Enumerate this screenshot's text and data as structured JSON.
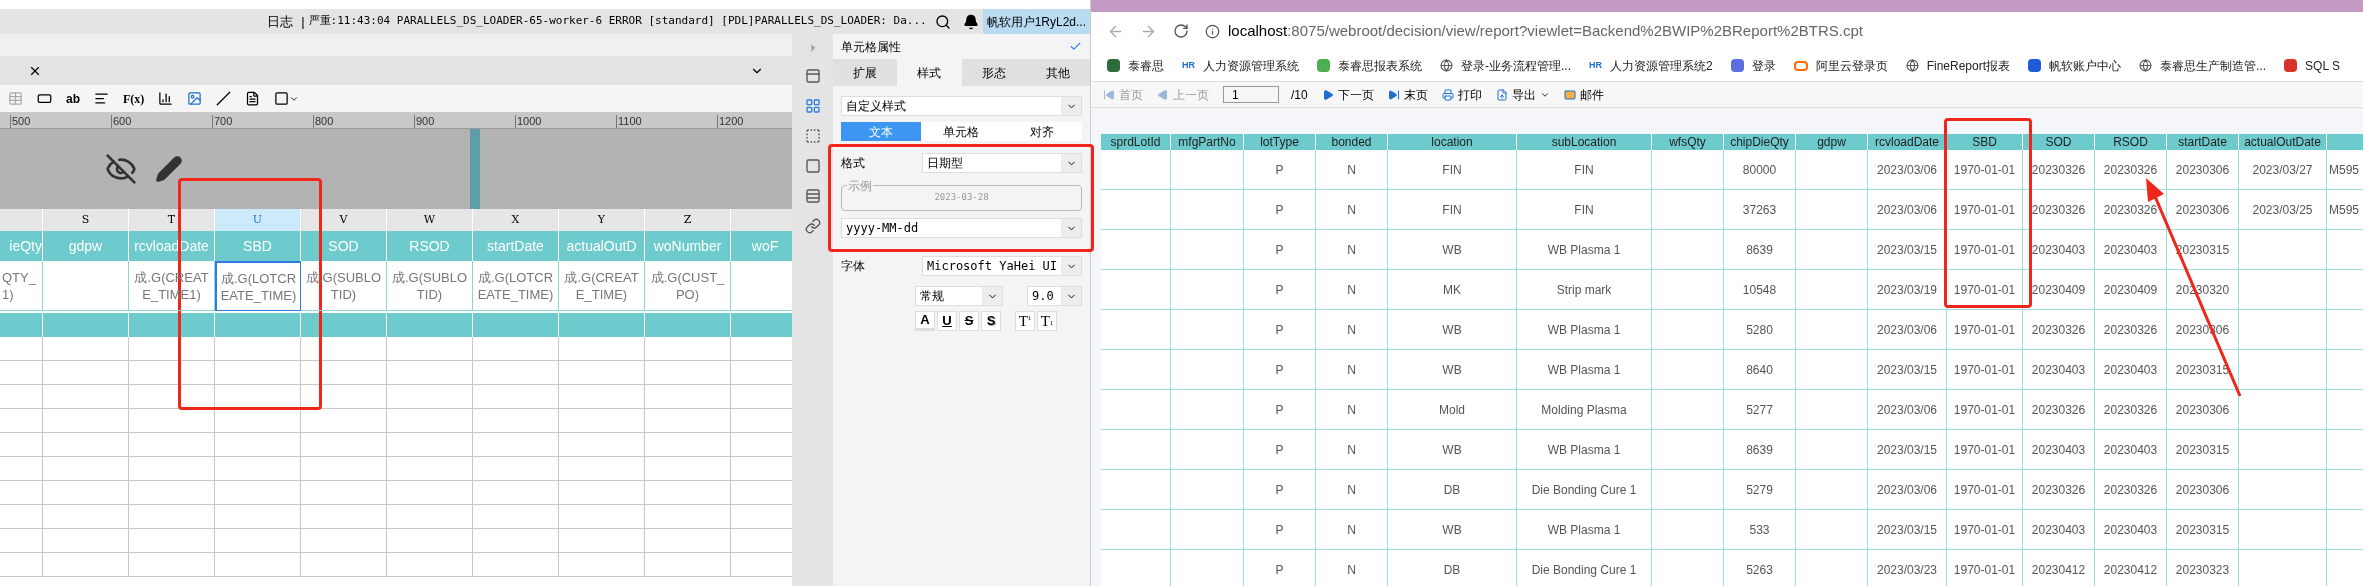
{
  "log_bar": {
    "label": "日志",
    "separator": "|",
    "message": "严重:11:43:04 PARALLELS_DS_LOADER-65-worker-6 ERROR [standard] [PDL]PARALLELS_DS_LOADER: Da...",
    "user": "帆软用户1RyL2d..."
  },
  "designer": {
    "toolbar_text": {
      "text_tool": "ab",
      "formula_tool": "F(x)"
    },
    "ruler": [
      "500",
      "600",
      "700",
      "800",
      "900",
      "1000",
      "1100",
      "1200"
    ],
    "columns": [
      {
        "header": "ieQty",
        "cell": "QTY_1)",
        "selected": false
      },
      {
        "letter": "S",
        "header": "gdpw",
        "selected": false
      },
      {
        "letter": "T",
        "header": "rcvloadDate",
        "cell": "成.G(CREATE_TIME1)",
        "selected": false
      },
      {
        "letter": "U",
        "header": "SBD",
        "cell": "成.G(LOTCREATE_TIME)",
        "selected": true
      },
      {
        "letter": "V",
        "header": "SOD",
        "cell": "成.G(SUBLOTID)",
        "selected": false
      },
      {
        "letter": "W",
        "header": "RSOD",
        "cell": "成.G(SUBLOTID)",
        "selected": false
      },
      {
        "letter": "X",
        "header": "startDate",
        "cell": "成.G(LOTCREATE_TIME)",
        "selected": false
      },
      {
        "letter": "Y",
        "header": "actualOutD",
        "cell": "成.G(CREATE_TIME)",
        "selected": false
      },
      {
        "letter": "Z",
        "header": "woNumber",
        "cell": "成.G(CUST_PO)",
        "selected": false
      },
      {
        "header": "woF",
        "selected": false
      }
    ]
  },
  "property_panel": {
    "title": "单元格属性",
    "tabs": [
      {
        "label": "扩展",
        "selected": false
      },
      {
        "label": "样式",
        "selected": true
      },
      {
        "label": "形态",
        "selected": false
      },
      {
        "label": "其他",
        "selected": false
      }
    ],
    "style_select": "自定义样式",
    "subtabs": [
      {
        "label": "文本",
        "selected": true
      },
      {
        "label": "单元格",
        "selected": false
      },
      {
        "label": "对齐",
        "selected": false
      }
    ],
    "format_label": "格式",
    "format_value": "日期型",
    "example_label": "示例",
    "example_value": "2023-03-28",
    "pattern": "yyyy-MM-dd",
    "font_label": "字体",
    "font_value": "Microsoft YaHei UI",
    "font_style": "常规",
    "font_size": "9.0",
    "style_buttons": [
      {
        "kind": "color",
        "label": "A"
      },
      {
        "kind": "underline",
        "label": "U"
      },
      {
        "kind": "strike",
        "label": "S"
      },
      {
        "kind": "shadow",
        "label": "S"
      },
      {
        "kind": "sup",
        "label": "T",
        "mark": "1"
      },
      {
        "kind": "sub",
        "label": "T",
        "mark": "1"
      }
    ]
  },
  "browser": {
    "url_host": "localhost",
    "url_rest": ":8075/webroot/decision/view/report?viewlet=Backend%2BWIP%2BReport%2BTRS.cpt",
    "bookmarks": [
      {
        "kind": "logo",
        "label": "泰睿思",
        "color": "#2e6b3a"
      },
      {
        "kind": "hr",
        "badge": "HR",
        "label": "人力资源管理系统"
      },
      {
        "kind": "logo",
        "label": "泰睿思报表系统",
        "color": "#4caf50"
      },
      {
        "kind": "globe",
        "label": "登录-业务流程管理..."
      },
      {
        "kind": "hr",
        "badge": "HR",
        "label": "人力资源管理系统2"
      },
      {
        "kind": "logo",
        "label": "登录",
        "color": "#5b6ee1"
      },
      {
        "kind": "bracket",
        "label": "阿里云登录页"
      },
      {
        "kind": "globe",
        "label": "FineReport报表"
      },
      {
        "kind": "logo",
        "label": "帆软账户中心",
        "color": "#1e5bd6"
      },
      {
        "kind": "globe",
        "label": "泰睿思生产制造管..."
      },
      {
        "kind": "logo",
        "label": "SQL S",
        "color": "#d9342b"
      }
    ],
    "report_toolbar": [
      {
        "kind": "first",
        "label": "首页",
        "disabled": true
      },
      {
        "kind": "prev",
        "label": "上一页",
        "disabled": true
      },
      {
        "kind": "page",
        "value": "1",
        "total": "/10"
      },
      {
        "kind": "next",
        "label": "下一页",
        "disabled": false
      },
      {
        "kind": "last",
        "label": "末页",
        "disabled": false
      },
      {
        "kind": "print",
        "label": "打印",
        "disabled": false
      },
      {
        "kind": "export",
        "label": "导出",
        "disabled": false
      },
      {
        "kind": "mail",
        "label": "邮件",
        "disabled": false
      }
    ],
    "table": {
      "columns": [
        {
          "label": "sprdLotId"
        },
        {
          "label": "mfgPartNo"
        },
        {
          "label": "lotType"
        },
        {
          "label": "bonded"
        },
        {
          "label": "location"
        },
        {
          "label": "subLocation"
        },
        {
          "label": "wfsQty"
        },
        {
          "label": "chipDieQty"
        },
        {
          "label": "gdpw"
        },
        {
          "label": "rcvloadDate"
        },
        {
          "label": "SBD"
        },
        {
          "label": "SOD"
        },
        {
          "label": "RSOD"
        },
        {
          "label": "startDate"
        },
        {
          "label": "actualOutDate"
        },
        {}
      ],
      "rows": [
        {
          "lot_type": "P",
          "bonded": "N",
          "location": "FIN",
          "sub_location": "FIN",
          "chip_die_qty": "80000",
          "rcvload_date": "2023/03/06",
          "sbd": "1970-01-01",
          "sod": "20230326",
          "rsod": "20230326",
          "start_date": "20230306",
          "actual_out_date": "2023/03/27",
          "column_16": "M595"
        },
        {
          "lot_type": "P",
          "bonded": "N",
          "location": "FIN",
          "sub_location": "FIN",
          "chip_die_qty": "37263",
          "rcvload_date": "2023/03/06",
          "sbd": "1970-01-01",
          "sod": "20230326",
          "rsod": "20230326",
          "start_date": "20230306",
          "actual_out_date": "2023/03/25",
          "column_16": "M595"
        },
        {
          "lot_type": "P",
          "bonded": "N",
          "location": "WB",
          "sub_location": "WB Plasma 1",
          "chip_die_qty": "8639",
          "rcvload_date": "2023/03/15",
          "sbd": "1970-01-01",
          "sod": "20230403",
          "rsod": "20230403",
          "start_date": "20230315"
        },
        {
          "lot_type": "P",
          "bonded": "N",
          "location": "MK",
          "sub_location": "Strip mark",
          "chip_die_qty": "10548",
          "rcvload_date": "2023/03/19",
          "sbd": "1970-01-01",
          "sod": "20230409",
          "rsod": "20230409",
          "start_date": "20230320"
        },
        {
          "lot_type": "P",
          "bonded": "N",
          "location": "WB",
          "sub_location": "WB Plasma 1",
          "chip_die_qty": "5280",
          "rcvload_date": "2023/03/06",
          "sbd": "1970-01-01",
          "sod": "20230326",
          "rsod": "20230326",
          "start_date": "20230306"
        },
        {
          "lot_type": "P",
          "bonded": "N",
          "location": "WB",
          "sub_location": "WB Plasma 1",
          "chip_die_qty": "8640",
          "rcvload_date": "2023/03/15",
          "sbd": "1970-01-01",
          "sod": "20230403",
          "rsod": "20230403",
          "start_date": "20230315"
        },
        {
          "lot_type": "P",
          "bonded": "N",
          "location": "Mold",
          "sub_location": "Molding Plasma",
          "chip_die_qty": "5277",
          "rcvload_date": "2023/03/06",
          "sbd": "1970-01-01",
          "sod": "20230326",
          "rsod": "20230326",
          "start_date": "20230306"
        },
        {
          "lot_type": "P",
          "bonded": "N",
          "location": "WB",
          "sub_location": "WB Plasma 1",
          "chip_die_qty": "8639",
          "rcvload_date": "2023/03/15",
          "sbd": "1970-01-01",
          "sod": "20230403",
          "rsod": "20230403",
          "start_date": "20230315"
        },
        {
          "lot_type": "P",
          "bonded": "N",
          "location": "DB",
          "sub_location": "Die Bonding Cure 1",
          "chip_die_qty": "5279",
          "rcvload_date": "2023/03/06",
          "sbd": "1970-01-01",
          "sod": "20230326",
          "rsod": "20230326",
          "start_date": "20230306"
        },
        {
          "lot_type": "P",
          "bonded": "N",
          "location": "WB",
          "sub_location": "WB Plasma 1",
          "chip_die_qty": "533",
          "rcvload_date": "2023/03/15",
          "sbd": "1970-01-01",
          "sod": "20230403",
          "rsod": "20230403",
          "start_date": "20230315"
        },
        {
          "lot_type": "P",
          "bonded": "N",
          "location": "DB",
          "sub_location": "Die Bonding Cure 1",
          "chip_die_qty": "5263",
          "rcvload_date": "2023/03/23",
          "sbd": "1970-01-01",
          "sod": "20230412",
          "rsod": "20230412",
          "start_date": "20230323"
        }
      ]
    }
  }
}
